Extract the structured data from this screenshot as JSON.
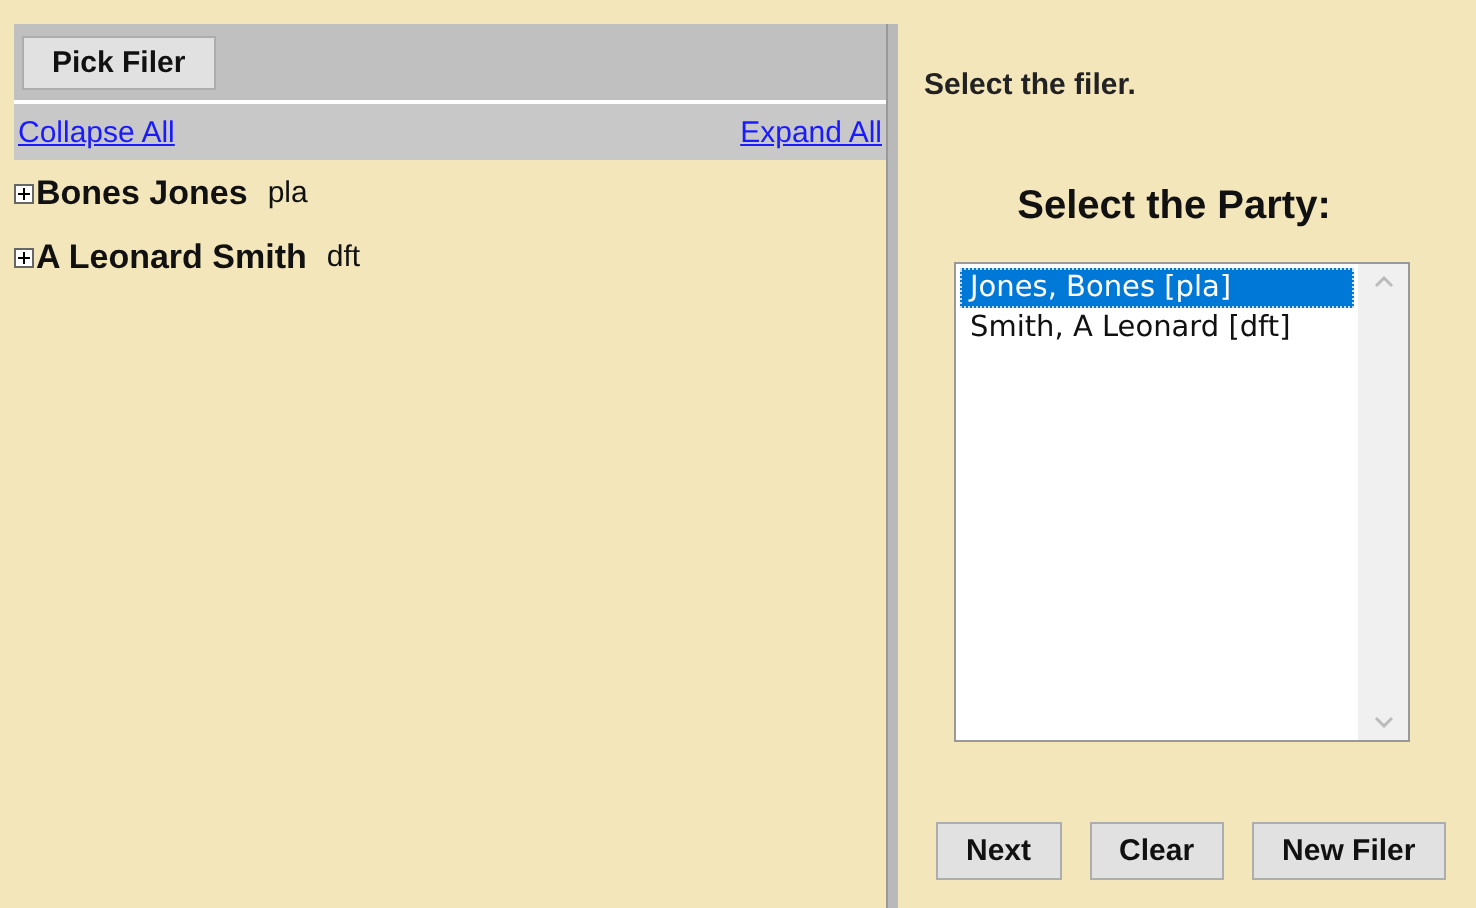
{
  "left_pane": {
    "toolbar_button": "Pick Filer",
    "collapse_link": "Collapse All",
    "expand_link": "Expand All",
    "tree": [
      {
        "name": "Bones Jones",
        "role": "pla",
        "expanded": false
      },
      {
        "name": "A Leonard Smith",
        "role": "dft",
        "expanded": false
      }
    ]
  },
  "right_pane": {
    "instruction": "Select the filer.",
    "heading": "Select the Party:",
    "parties": [
      {
        "label": "Jones, Bones [pla]",
        "selected": true
      },
      {
        "label": "Smith, A Leonard [dft]",
        "selected": false
      }
    ],
    "buttons": [
      "Next",
      "Clear",
      "New Filer"
    ]
  }
}
